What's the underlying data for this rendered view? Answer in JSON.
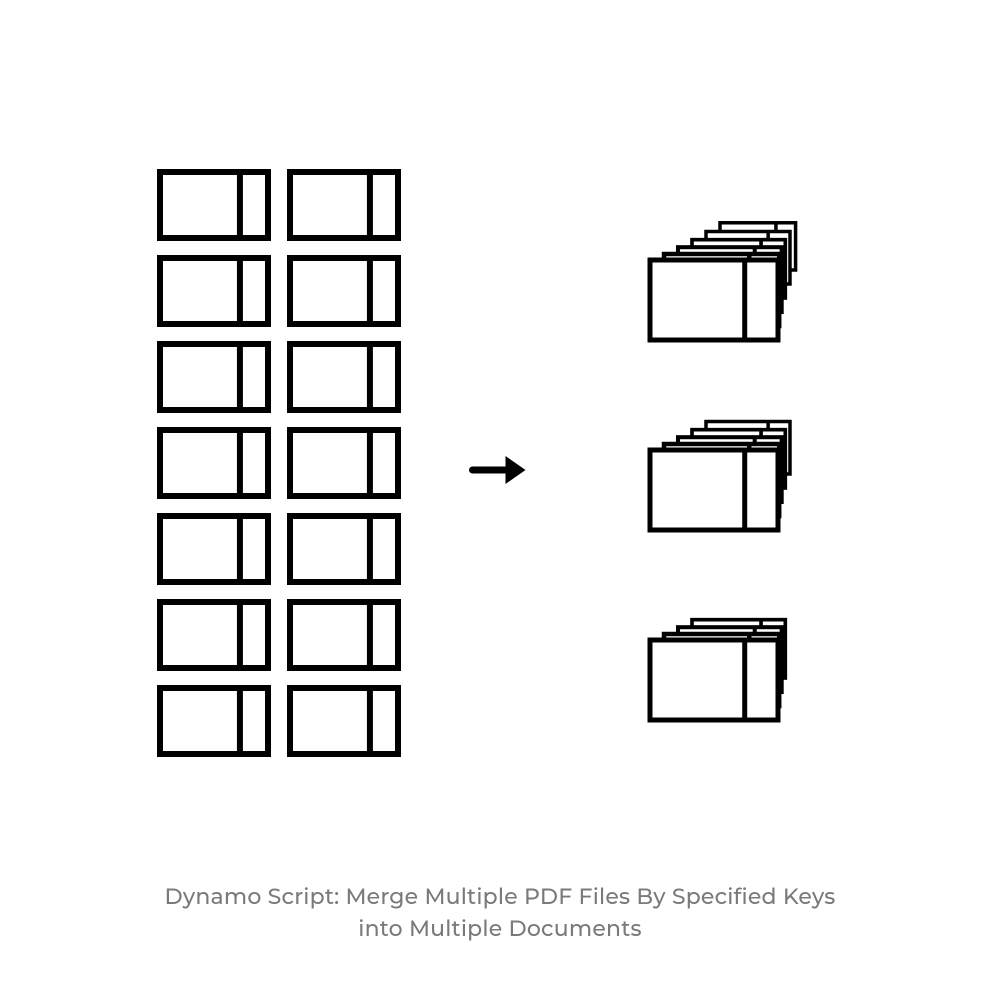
{
  "caption_line1": "Dynamo Script: Merge Multiple PDF Files By Specified Keys",
  "caption_line2": "into Multiple Documents",
  "diagram": {
    "input_grid": {
      "rows": 7,
      "cols": 2
    },
    "output_stacks": [
      6,
      5,
      4
    ],
    "arrow": "right"
  },
  "colors": {
    "stroke": "#000000",
    "caption": "#7a7a7a",
    "bg": "#ffffff"
  }
}
